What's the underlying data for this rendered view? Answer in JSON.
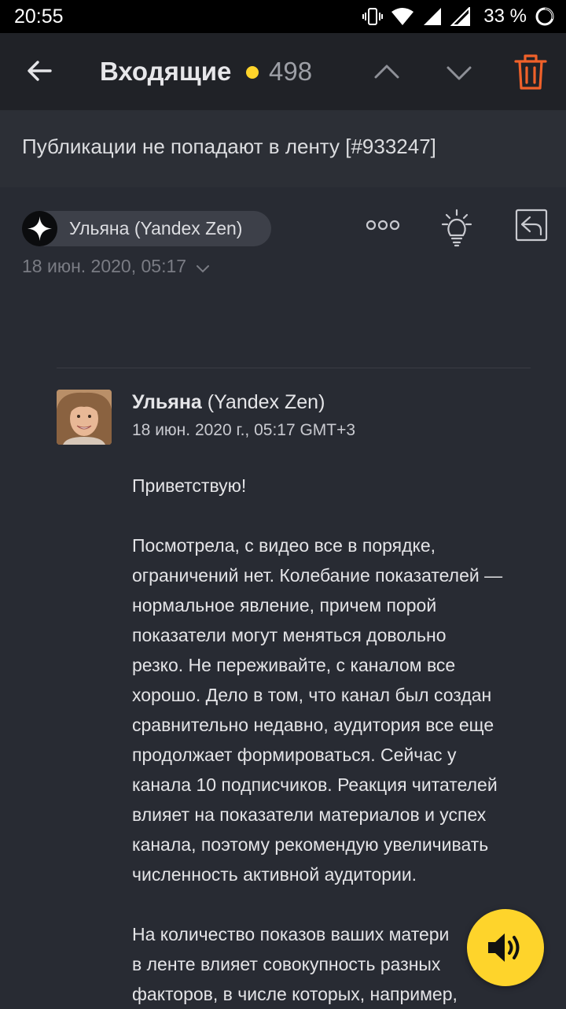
{
  "status_bar": {
    "time": "20:55",
    "battery": "33 %"
  },
  "toolbar": {
    "folder": "Входящие",
    "unread_count": "498",
    "accent_color": "#fed42b",
    "delete_color": "#f0612a"
  },
  "subject": "Публикации не попадают в ленту [#933247]",
  "header": {
    "sender": "Ульяна (Yandex Zen)",
    "date": "18 июн. 2020, 05:17"
  },
  "message": {
    "from_name": "Ульяна",
    "from_org": "(Yandex Zen)",
    "date": "18 июн. 2020 г., 05:17 GMT+3",
    "greeting": "Приветствую!",
    "paragraph1": [
      "Посмотрела, с видео все в порядке,",
      "ограничений нет. Колебание показателей —",
      "нормальное явление, причем порой",
      "показатели могут меняться довольно",
      "резко. Не переживайте, с каналом все",
      "хорошо. Дело в том, что канал был создан",
      "сравнительно недавно, аудитория все еще",
      "продолжает формироваться. Сейчас у",
      "канала 10 подписчиков. Реакция читателей",
      "влияет на показатели материалов и успех",
      "канала, поэтому рекомендую увеличивать",
      "численность активной аудитории."
    ],
    "paragraph2": [
      "На количество показов ваших матери",
      "в ленте влияет совокупность разных",
      "факторов, в числе которых, например,"
    ]
  },
  "icons": {
    "back": "arrow-left-icon",
    "up": "chevron-up-icon",
    "down": "chevron-down-icon",
    "delete": "trash-icon",
    "more": "more-dots-icon",
    "bulb": "lightbulb-icon",
    "reply": "reply-icon",
    "speaker": "speaker-icon"
  }
}
